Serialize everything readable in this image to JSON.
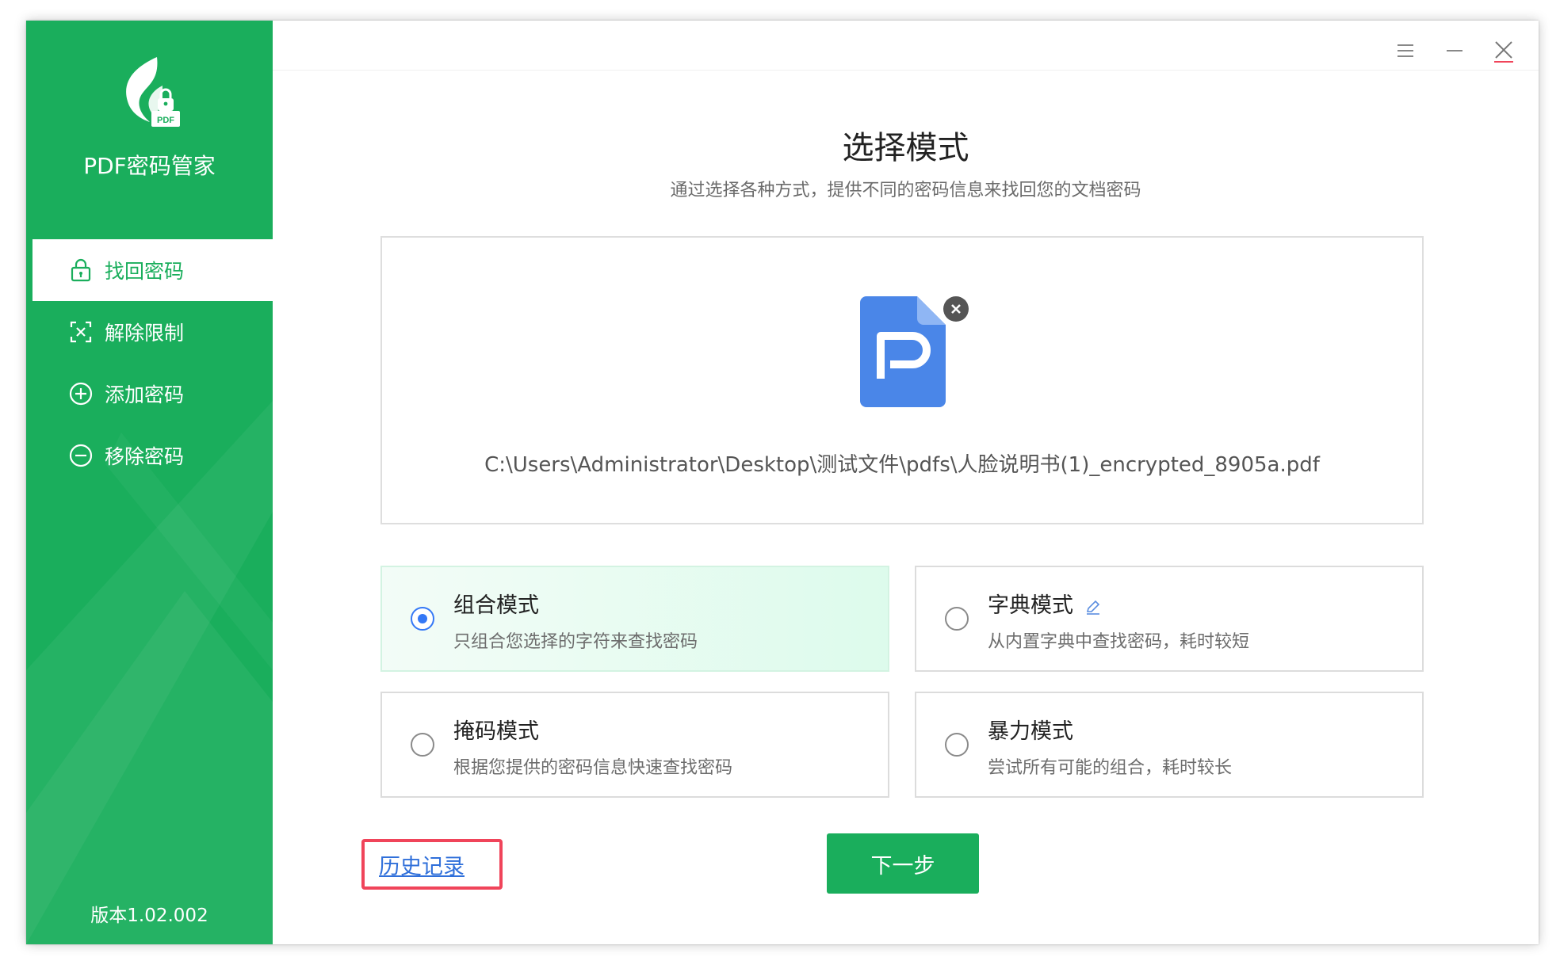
{
  "app": {
    "title": "PDF密码管家",
    "version": "版本1.02.002",
    "logo_badge": "PDF"
  },
  "sidebar": {
    "items": [
      {
        "label": "找回密码",
        "icon": "lock-icon",
        "active": true
      },
      {
        "label": "解除限制",
        "icon": "unlock-frame-icon",
        "active": false
      },
      {
        "label": "添加密码",
        "icon": "plus-circle-icon",
        "active": false
      },
      {
        "label": "移除密码",
        "icon": "minus-circle-icon",
        "active": false
      }
    ]
  },
  "window_controls": [
    "menu-icon",
    "minimize-icon",
    "close-icon"
  ],
  "main": {
    "title": "选择模式",
    "subtitle": "通过选择各种方式，提供不同的密码信息来找回您的文档密码",
    "file": {
      "path": "C:\\Users\\Administrator\\Desktop\\测试文件\\pdfs\\人脸说明书(1)_encrypted_8905a.pdf"
    },
    "modes": [
      {
        "name": "组合模式",
        "desc": "只组合您选择的字符来查找密码",
        "selected": true
      },
      {
        "name": "字典模式",
        "desc": "从内置字典中查找密码，耗时较短",
        "selected": false,
        "has_edit_icon": true
      },
      {
        "name": "掩码模式",
        "desc": "根据您提供的密码信息快速查找密码",
        "selected": false
      },
      {
        "name": "暴力模式",
        "desc": "尝试所有可能的组合，耗时较长",
        "selected": false
      }
    ],
    "history_label": "历史记录",
    "next_label": "下一步"
  },
  "colors": {
    "brand_green": "#1aae5c",
    "radio_blue": "#3478f6",
    "link_blue": "#2f6fda",
    "highlight_red": "#f0445a",
    "file_icon_blue": "#4a86e8"
  }
}
